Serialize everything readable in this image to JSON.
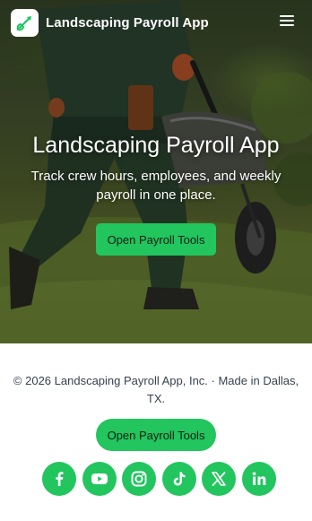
{
  "header": {
    "app_name": "Landscaping Payroll App",
    "logo_icon": "shovel-icon",
    "menu_icon": "hamburger-menu-icon"
  },
  "hero": {
    "title": "Landscaping Payroll App",
    "subtitle": "Track crew hours, employees, and weekly payroll in one place.",
    "cta_label": "Open Payroll Tools"
  },
  "footer": {
    "copyright": "© 2026 Landscaping Payroll App, Inc. · Made in Dallas, TX.",
    "cta_label": "Open Payroll Tools",
    "socials": [
      "facebook-icon",
      "youtube-icon",
      "instagram-icon",
      "tiktok-icon",
      "x-icon",
      "linkedin-icon"
    ]
  },
  "colors": {
    "accent": "#22c55e",
    "footer_text": "#374151"
  }
}
